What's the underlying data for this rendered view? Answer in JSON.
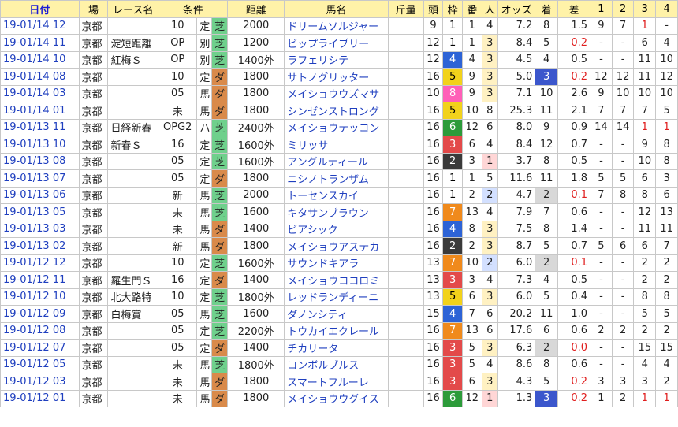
{
  "headers": [
    "日付",
    "場",
    "レース名",
    "条件",
    "",
    "",
    "距離",
    "馬名",
    "斤量",
    "頭",
    "枠",
    "番",
    "人",
    "オッズ",
    "着",
    "差",
    "1",
    "2",
    "3",
    "4"
  ],
  "rows": [
    {
      "date": "19-01/14 12",
      "place": "京都",
      "race": "",
      "cond": "10",
      "kind": "定",
      "track": "芝",
      "dist": "2000",
      "horse": "ドリームソルジャー",
      "weight": "",
      "heads": "9",
      "waku": "1",
      "num": "1",
      "pop": "4",
      "odds": "7.2",
      "rank": "8",
      "diff": "1.5",
      "c1": "9",
      "c2": "7",
      "c3": "1",
      "c4": "-"
    },
    {
      "date": "19-01/14 11",
      "place": "京都",
      "race": "淀短距離",
      "cond": "OP",
      "kind": "別",
      "track": "芝",
      "dist": "1200",
      "horse": "ビップライブリー",
      "weight": "",
      "heads": "12",
      "waku": "1",
      "num": "1",
      "pop": "3",
      "odds": "8.4",
      "rank": "5",
      "diff": "0.2",
      "c1": "-",
      "c2": "-",
      "c3": "6",
      "c4": "4"
    },
    {
      "date": "19-01/14 10",
      "place": "京都",
      "race": "紅梅Ｓ",
      "cond": "OP",
      "kind": "別",
      "track": "芝",
      "dist": "1400外",
      "horse": "ラフェリシテ",
      "weight": "",
      "heads": "12",
      "waku": "4",
      "num": "4",
      "pop": "3",
      "odds": "4.5",
      "rank": "4",
      "diff": "0.5",
      "c1": "-",
      "c2": "-",
      "c3": "11",
      "c4": "10"
    },
    {
      "date": "19-01/14 08",
      "place": "京都",
      "race": "",
      "cond": "10",
      "kind": "定",
      "track": "ダ",
      "dist": "1800",
      "horse": "サトノグリッター",
      "weight": "",
      "heads": "16",
      "waku": "5",
      "num": "9",
      "pop": "3",
      "odds": "5.0",
      "rank": "3",
      "diff": "0.2",
      "c1": "12",
      "c2": "12",
      "c3": "11",
      "c4": "12"
    },
    {
      "date": "19-01/14 03",
      "place": "京都",
      "race": "",
      "cond": "05",
      "kind": "馬",
      "track": "ダ",
      "dist": "1800",
      "horse": "メイショウウズマサ",
      "weight": "",
      "heads": "10",
      "waku": "8",
      "num": "9",
      "pop": "3",
      "odds": "7.1",
      "rank": "10",
      "diff": "2.6",
      "c1": "9",
      "c2": "10",
      "c3": "10",
      "c4": "10"
    },
    {
      "date": "19-01/14 01",
      "place": "京都",
      "race": "",
      "cond": "未",
      "kind": "馬",
      "track": "ダ",
      "dist": "1800",
      "horse": "シンゼンストロング",
      "weight": "",
      "heads": "16",
      "waku": "5",
      "num": "10",
      "pop": "8",
      "odds": "25.3",
      "rank": "11",
      "diff": "2.1",
      "c1": "7",
      "c2": "7",
      "c3": "7",
      "c4": "5"
    },
    {
      "date": "19-01/13 11",
      "place": "京都",
      "race": "日経新春",
      "cond": "OPG2",
      "kind": "ハ",
      "track": "芝",
      "dist": "2400外",
      "horse": "メイショウテッコン",
      "weight": "",
      "heads": "16",
      "waku": "6",
      "num": "12",
      "pop": "6",
      "odds": "8.0",
      "rank": "9",
      "diff": "0.9",
      "c1": "14",
      "c2": "14",
      "c3": "1",
      "c4": "1"
    },
    {
      "date": "19-01/13 10",
      "place": "京都",
      "race": "新春Ｓ",
      "cond": "16",
      "kind": "定",
      "track": "芝",
      "dist": "1600外",
      "horse": "ミリッサ",
      "weight": "",
      "heads": "16",
      "waku": "3",
      "num": "6",
      "pop": "4",
      "odds": "8.4",
      "rank": "12",
      "diff": "0.7",
      "c1": "-",
      "c2": "-",
      "c3": "9",
      "c4": "8"
    },
    {
      "date": "19-01/13 08",
      "place": "京都",
      "race": "",
      "cond": "05",
      "kind": "定",
      "track": "芝",
      "dist": "1600外",
      "horse": "アングルティール",
      "weight": "",
      "heads": "16",
      "waku": "2",
      "num": "3",
      "pop": "1",
      "odds": "3.7",
      "rank": "8",
      "diff": "0.5",
      "c1": "-",
      "c2": "-",
      "c3": "10",
      "c4": "8"
    },
    {
      "date": "19-01/13 07",
      "place": "京都",
      "race": "",
      "cond": "05",
      "kind": "定",
      "track": "ダ",
      "dist": "1800",
      "horse": "ニシノトランザム",
      "weight": "",
      "heads": "16",
      "waku": "1",
      "num": "1",
      "pop": "5",
      "odds": "11.6",
      "rank": "11",
      "diff": "1.8",
      "c1": "5",
      "c2": "5",
      "c3": "6",
      "c4": "3"
    },
    {
      "date": "19-01/13 06",
      "place": "京都",
      "race": "",
      "cond": "新",
      "kind": "馬",
      "track": "芝",
      "dist": "2000",
      "horse": "トーセンスカイ",
      "weight": "",
      "heads": "16",
      "waku": "1",
      "num": "2",
      "pop": "2",
      "odds": "4.7",
      "rank": "2",
      "diff": "0.1",
      "c1": "7",
      "c2": "8",
      "c3": "8",
      "c4": "6"
    },
    {
      "date": "19-01/13 05",
      "place": "京都",
      "race": "",
      "cond": "未",
      "kind": "馬",
      "track": "芝",
      "dist": "1600",
      "horse": "キタサンブラウン",
      "weight": "",
      "heads": "16",
      "waku": "7",
      "num": "13",
      "pop": "4",
      "odds": "7.9",
      "rank": "7",
      "diff": "0.6",
      "c1": "-",
      "c2": "-",
      "c3": "12",
      "c4": "13"
    },
    {
      "date": "19-01/13 03",
      "place": "京都",
      "race": "",
      "cond": "未",
      "kind": "馬",
      "track": "ダ",
      "dist": "1400",
      "horse": "ビアシック",
      "weight": "",
      "heads": "16",
      "waku": "4",
      "num": "8",
      "pop": "3",
      "odds": "7.5",
      "rank": "8",
      "diff": "1.4",
      "c1": "-",
      "c2": "-",
      "c3": "11",
      "c4": "11"
    },
    {
      "date": "19-01/13 02",
      "place": "京都",
      "race": "",
      "cond": "新",
      "kind": "馬",
      "track": "ダ",
      "dist": "1800",
      "horse": "メイショウアステカ",
      "weight": "",
      "heads": "16",
      "waku": "2",
      "num": "2",
      "pop": "3",
      "odds": "8.7",
      "rank": "5",
      "diff": "0.7",
      "c1": "5",
      "c2": "6",
      "c3": "6",
      "c4": "7"
    },
    {
      "date": "19-01/12 12",
      "place": "京都",
      "race": "",
      "cond": "10",
      "kind": "定",
      "track": "芝",
      "dist": "1600外",
      "horse": "サウンドキアラ",
      "weight": "",
      "heads": "13",
      "waku": "7",
      "num": "10",
      "pop": "2",
      "odds": "6.0",
      "rank": "2",
      "diff": "0.1",
      "c1": "-",
      "c2": "-",
      "c3": "2",
      "c4": "2"
    },
    {
      "date": "19-01/12 11",
      "place": "京都",
      "race": "羅生門Ｓ",
      "cond": "16",
      "kind": "定",
      "track": "ダ",
      "dist": "1400",
      "horse": "メイショウココロミ",
      "weight": "",
      "heads": "13",
      "waku": "3",
      "num": "3",
      "pop": "4",
      "odds": "7.3",
      "rank": "4",
      "diff": "0.5",
      "c1": "-",
      "c2": "-",
      "c3": "2",
      "c4": "2"
    },
    {
      "date": "19-01/12 10",
      "place": "京都",
      "race": "北大路特",
      "cond": "10",
      "kind": "定",
      "track": "芝",
      "dist": "1800外",
      "horse": "レッドランディーニ",
      "weight": "",
      "heads": "13",
      "waku": "5",
      "num": "6",
      "pop": "3",
      "odds": "6.0",
      "rank": "5",
      "diff": "0.4",
      "c1": "-",
      "c2": "-",
      "c3": "8",
      "c4": "8"
    },
    {
      "date": "19-01/12 09",
      "place": "京都",
      "race": "白梅賞",
      "cond": "05",
      "kind": "馬",
      "track": "芝",
      "dist": "1600",
      "horse": "ダノンシティ",
      "weight": "",
      "heads": "15",
      "waku": "4",
      "num": "7",
      "pop": "6",
      "odds": "20.2",
      "rank": "11",
      "diff": "1.0",
      "c1": "-",
      "c2": "-",
      "c3": "5",
      "c4": "5"
    },
    {
      "date": "19-01/12 08",
      "place": "京都",
      "race": "",
      "cond": "05",
      "kind": "定",
      "track": "芝",
      "dist": "2200外",
      "horse": "トウカイエクレール",
      "weight": "",
      "heads": "16",
      "waku": "7",
      "num": "13",
      "pop": "6",
      "odds": "17.6",
      "rank": "6",
      "diff": "0.6",
      "c1": "2",
      "c2": "2",
      "c3": "2",
      "c4": "2"
    },
    {
      "date": "19-01/12 07",
      "place": "京都",
      "race": "",
      "cond": "05",
      "kind": "定",
      "track": "ダ",
      "dist": "1400",
      "horse": "チカリータ",
      "weight": "",
      "heads": "16",
      "waku": "3",
      "num": "5",
      "pop": "3",
      "odds": "6.3",
      "rank": "2",
      "diff": "0.0",
      "c1": "-",
      "c2": "-",
      "c3": "15",
      "c4": "15"
    },
    {
      "date": "19-01/12 05",
      "place": "京都",
      "race": "",
      "cond": "未",
      "kind": "馬",
      "track": "芝",
      "dist": "1800外",
      "horse": "コンボルブルス",
      "weight": "",
      "heads": "16",
      "waku": "3",
      "num": "5",
      "pop": "4",
      "odds": "8.6",
      "rank": "8",
      "diff": "0.6",
      "c1": "-",
      "c2": "-",
      "c3": "4",
      "c4": "4"
    },
    {
      "date": "19-01/12 03",
      "place": "京都",
      "race": "",
      "cond": "未",
      "kind": "馬",
      "track": "ダ",
      "dist": "1800",
      "horse": "スマートフルーレ",
      "weight": "",
      "heads": "16",
      "waku": "3",
      "num": "6",
      "pop": "3",
      "odds": "4.3",
      "rank": "5",
      "diff": "0.2",
      "c1": "3",
      "c2": "3",
      "c3": "3",
      "c4": "2"
    },
    {
      "date": "19-01/12 01",
      "place": "京都",
      "race": "",
      "cond": "未",
      "kind": "馬",
      "track": "ダ",
      "dist": "1800",
      "horse": "メイショウウグイス",
      "weight": "",
      "heads": "16",
      "waku": "6",
      "num": "12",
      "pop": "1",
      "odds": "1.3",
      "rank": "3",
      "diff": "0.2",
      "c1": "1",
      "c2": "2",
      "c3": "1",
      "c4": "1"
    }
  ]
}
